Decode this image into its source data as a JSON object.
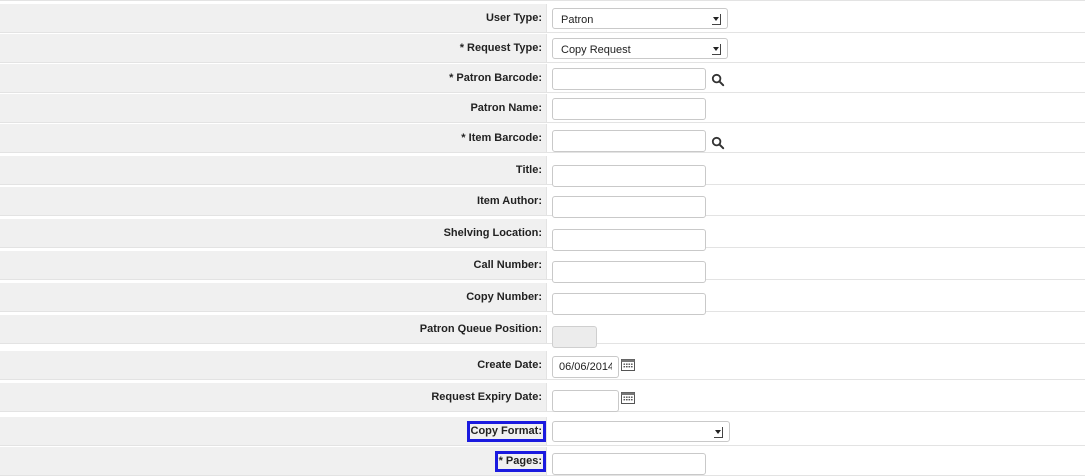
{
  "form": {
    "user_type": {
      "label": "User Type:",
      "value": "Patron"
    },
    "request_type": {
      "label": "* Request Type:",
      "value": "Copy Request"
    },
    "patron_barcode": {
      "label": "* Patron Barcode:",
      "value": ""
    },
    "patron_name": {
      "label": "Patron Name:",
      "value": ""
    },
    "item_barcode": {
      "label": "* Item Barcode:",
      "value": ""
    },
    "title": {
      "label": "Title:",
      "value": ""
    },
    "item_author": {
      "label": "Item Author:",
      "value": ""
    },
    "shelving_location": {
      "label": "Shelving Location:",
      "value": ""
    },
    "call_number": {
      "label": "Call Number:",
      "value": ""
    },
    "copy_number": {
      "label": "Copy Number:",
      "value": ""
    },
    "patron_queue_position": {
      "label": "Patron Queue Position:",
      "value": ""
    },
    "create_date": {
      "label": "Create Date:",
      "value": "06/06/2014"
    },
    "request_expiry_date": {
      "label": "Request Expiry Date:",
      "value": ""
    },
    "copy_format": {
      "label": "Copy Format:",
      "value": ""
    },
    "pages": {
      "label": "* Pages:",
      "value": ""
    }
  },
  "colors": {
    "label_background": "#f0f0f0",
    "row_border": "#e3e3e3",
    "highlight_box": "#1a1adf"
  },
  "icons": {
    "search": "magnifier-icon",
    "calendar": "calendar-icon",
    "dropdown": "chevron-down-icon"
  }
}
